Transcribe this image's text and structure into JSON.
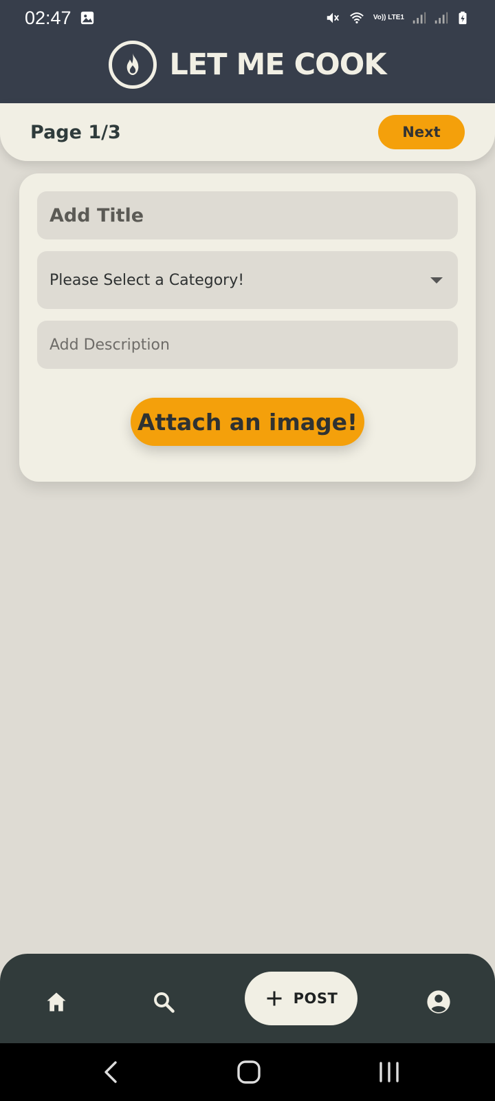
{
  "status_bar": {
    "time": "02:47",
    "network_label": "Vo)) LTE1"
  },
  "app": {
    "title": "LET ME COOK",
    "logo_icon": "flame-icon"
  },
  "pager": {
    "label": "Page 1/3",
    "next_label": "Next"
  },
  "form": {
    "title_placeholder": "Add Title",
    "category_value": "Please Select a Category!",
    "description_placeholder": "Add Description",
    "attach_label": "Attach an image!"
  },
  "bottom_nav": {
    "items": [
      {
        "icon": "home-icon"
      },
      {
        "icon": "search-icon"
      },
      {
        "icon": "plus-icon",
        "label": "POST"
      },
      {
        "icon": "account-circle-icon"
      }
    ]
  },
  "colors": {
    "header_bg": "#373e4b",
    "accent": "#f4a00b",
    "surface": "#f1efe4",
    "background": "#dedbd3",
    "nav_bg": "#313b3b"
  }
}
